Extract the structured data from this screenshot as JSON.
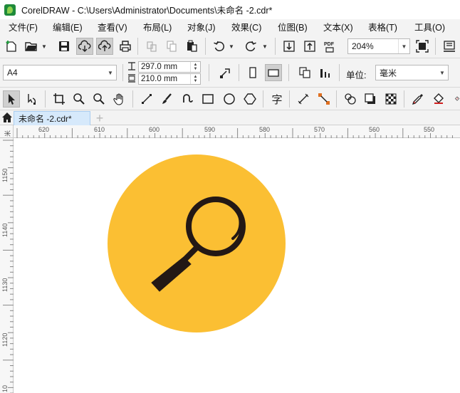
{
  "window": {
    "title": "CorelDRAW - C:\\Users\\Administrator\\Documents\\未命名 -2.cdr*"
  },
  "menu": {
    "items": [
      {
        "label": "文件(F)"
      },
      {
        "label": "编辑(E)"
      },
      {
        "label": "查看(V)"
      },
      {
        "label": "布局(L)"
      },
      {
        "label": "对象(J)"
      },
      {
        "label": "效果(C)"
      },
      {
        "label": "位图(B)"
      },
      {
        "label": "文本(X)"
      },
      {
        "label": "表格(T)"
      },
      {
        "label": "工具(O)"
      }
    ]
  },
  "standard_toolbar": {
    "zoom_value": "204%",
    "icons": [
      "new-document-icon",
      "open-folder-icon",
      "save-icon",
      "cloud-download-icon",
      "cloud-upload-icon",
      "print-icon",
      "cut-icon",
      "copy-icon",
      "paste-icon",
      "undo-icon",
      "redo-icon",
      "import-icon",
      "export-icon",
      "pdf-icon",
      "full-screen-icon",
      "options-icon"
    ],
    "pdf_label": "PDF"
  },
  "property_bar": {
    "page_size": "A4",
    "width": "297.0 mm",
    "height": "210.0 mm",
    "unit_label": "单位:",
    "unit_value": "毫米"
  },
  "tools": {
    "icons": [
      "pick-tool-icon",
      "shape-tool-icon",
      "crop-tool-icon",
      "zoom-tool-icon",
      "zoom-out-icon",
      "pan-tool-icon",
      "freehand-tool-icon",
      "artistic-media-icon",
      "spiral-icon",
      "rectangle-tool-icon",
      "ellipse-tool-icon",
      "polygon-tool-icon",
      "text-tool-icon",
      "parallel-dimension-icon",
      "connector-tool-icon",
      "blend-tool-icon",
      "drop-shadow-icon",
      "transparency-icon",
      "eyedropper-icon",
      "fill-tool-icon",
      "smart-fill-icon"
    ],
    "text_tool_glyph": "字"
  },
  "document_tabs": {
    "active_tab": "未命名 -2.cdr*",
    "add_tab": "+"
  },
  "rulers": {
    "horizontal": [
      "620",
      "610",
      "600",
      "590",
      "580",
      "570",
      "560",
      "550"
    ],
    "vertical": [
      "1150",
      "1140",
      "1130",
      "1120",
      "10"
    ],
    "corner_unit": "米"
  },
  "artwork": {
    "circle_color": "#FBBF33",
    "glass_color": "#231815",
    "icon": "magnifying-glass-icon"
  }
}
